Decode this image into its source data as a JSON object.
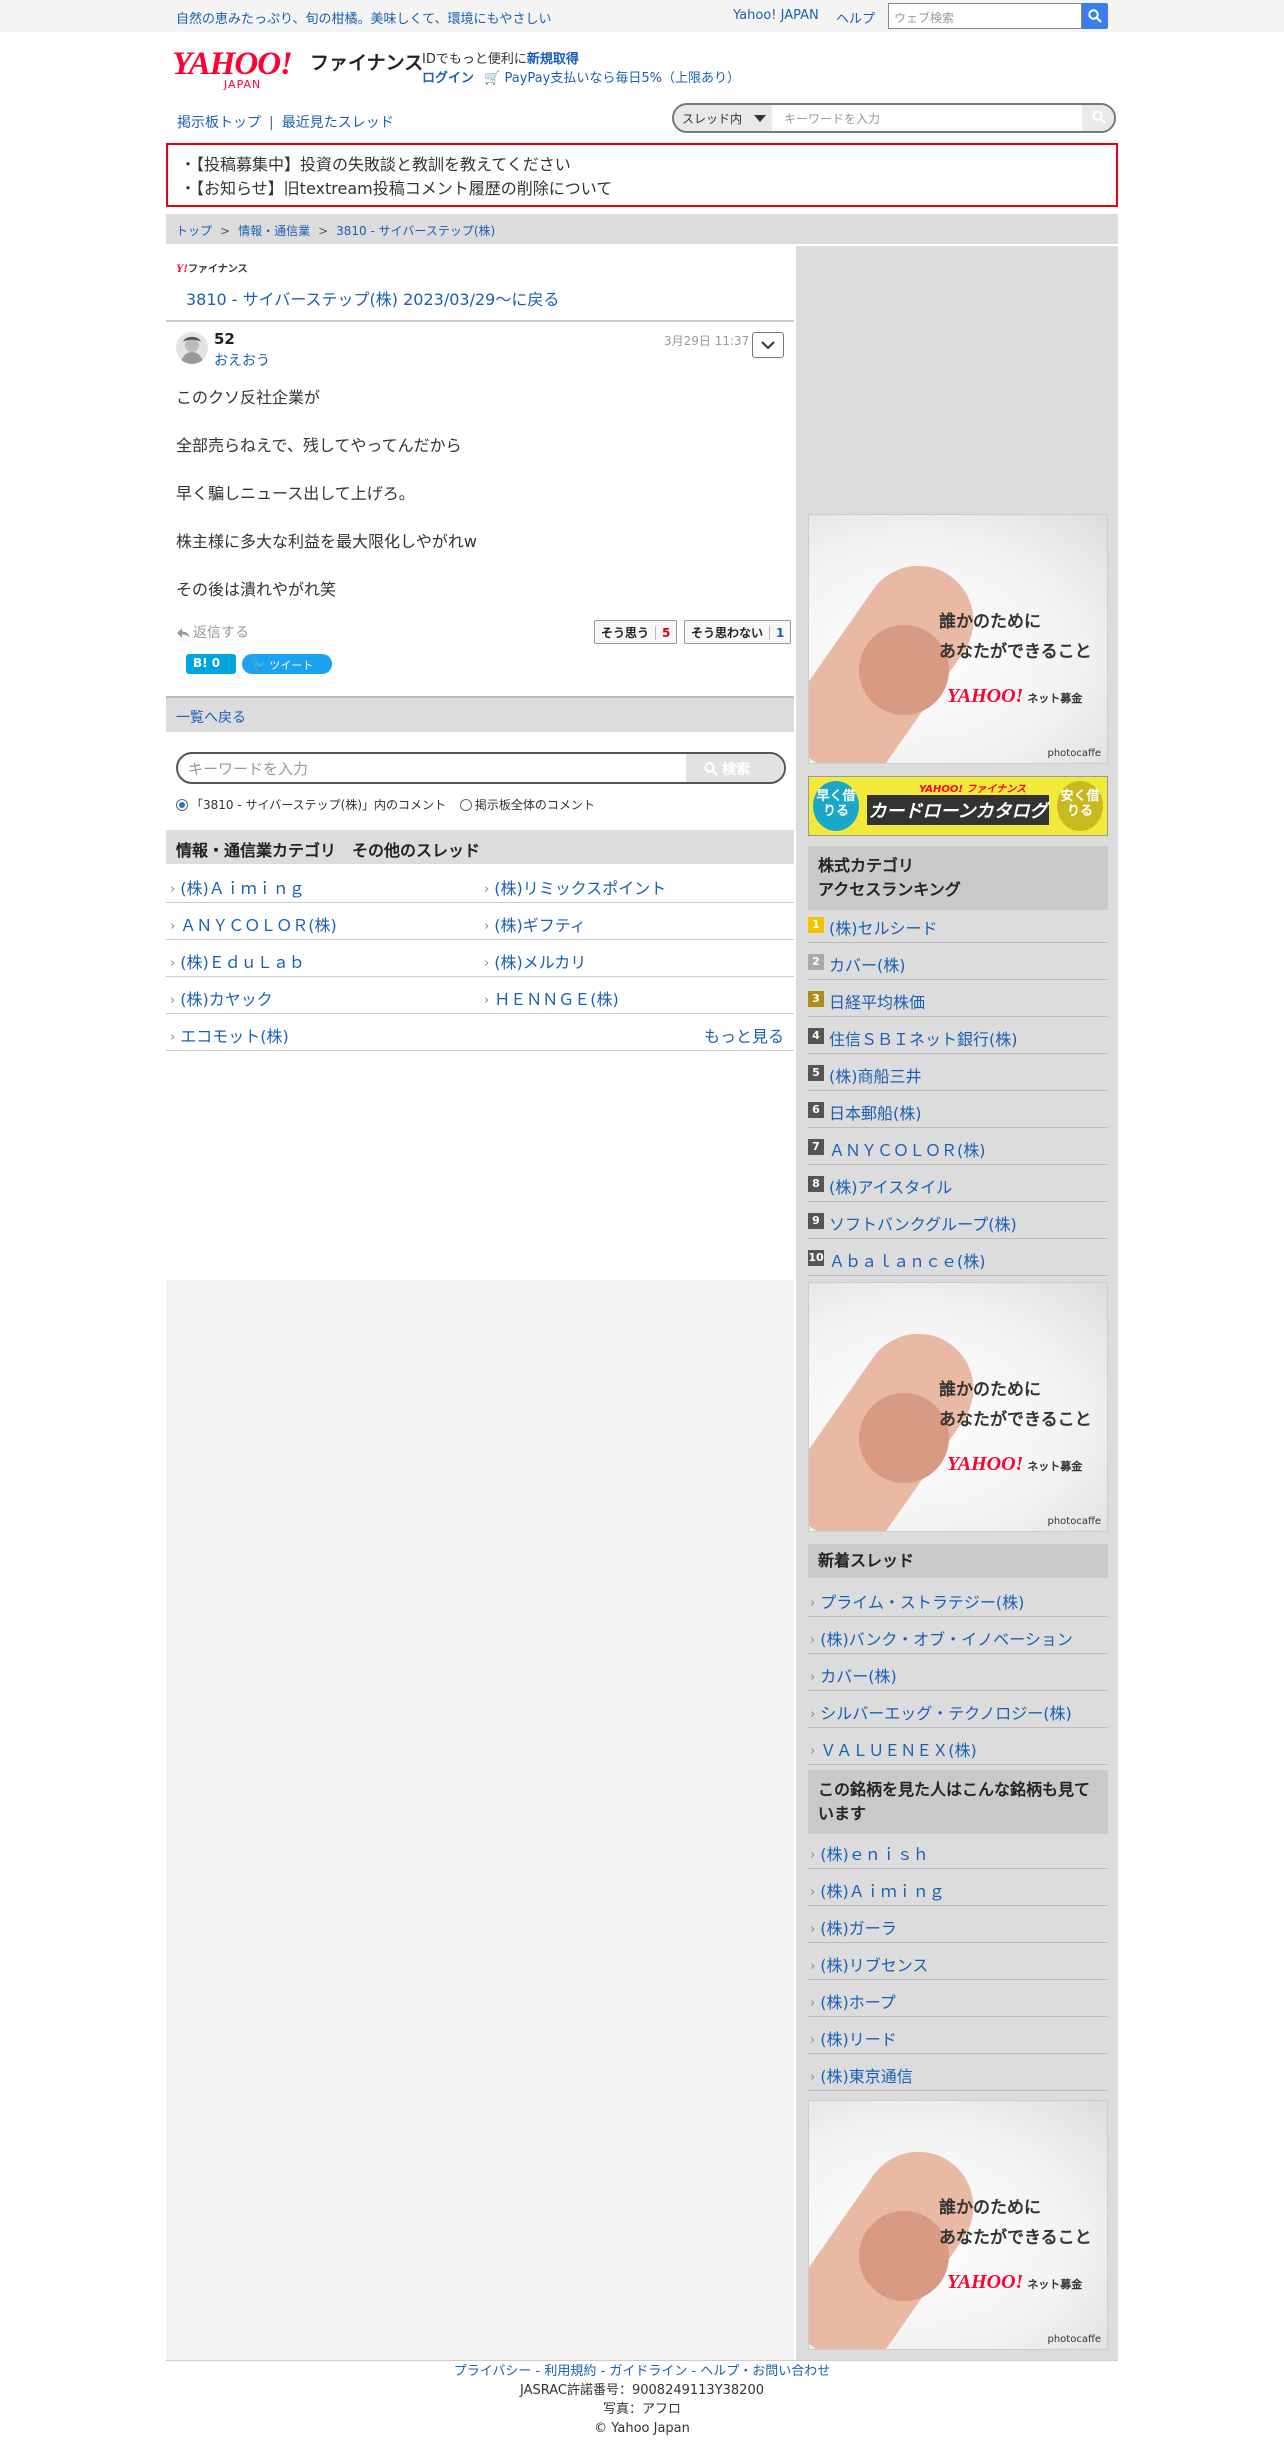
{
  "topbar": {
    "promo": "自然の恵みたっぷり、旬の柑橘。美味しくて、環境にもやさしい",
    "yahoo_japan": "Yahoo! JAPAN",
    "help": "ヘルプ",
    "web_search_placeholder": "ウェブ検索"
  },
  "header": {
    "logo": "YAHOO!",
    "logo_sub": "JAPAN",
    "brand": "ファイナンス",
    "id_text": "IDでもっと便利に",
    "signup": "新規取得",
    "login": "ログイン",
    "paypay": "PayPay支払いなら毎日5%（上限あり）"
  },
  "nav": {
    "board_top": "掲示板トップ",
    "sep": "|",
    "recent_threads": "最近見たスレッド",
    "search_scope": "スレッド内",
    "search_placeholder": "キーワードを入力"
  },
  "notices": [
    "・【投稿募集中】投資の失敗談と教訓を教えてください",
    "・【お知らせ】旧textream投稿コメント履歴の削除について"
  ],
  "breadcrumb": [
    "トップ",
    ">",
    "情報・通信業",
    ">",
    "3810 - サイバーステップ(株)"
  ],
  "post": {
    "mini_logo": "Y!",
    "mini_brand": "ファイナンス",
    "thread_back": "3810 - サイバーステップ(株) 2023/03/29〜に戻る",
    "number": "52",
    "user": "おえおう",
    "date": "3月29日 11:37",
    "lines": [
      "このクソ反社企業が",
      "",
      "全部売らねえで、残してやってんだから",
      "",
      "早く騙しニュース出して上げろ。",
      "",
      "株主様に多大な利益を最大限化しやがれw",
      "",
      "その後は潰れやがれ笑"
    ],
    "reply": "返信する",
    "agree_label": "そう思う",
    "agree_count": "5",
    "disagree_label": "そう思わない",
    "disagree_count": "1",
    "hatena": "B! 0",
    "tweet": "ツイート"
  },
  "list_back": "一覧へ戻る",
  "keyword_search": {
    "placeholder": "キーワードを入力",
    "button": "検索",
    "radio_thread": "「3810 - サイバーステップ(株)」内のコメント",
    "radio_all": "掲示板全体のコメント"
  },
  "other_threads": {
    "heading": "情報・通信業カテゴリ　その他のスレッド",
    "rows": [
      [
        "(株)Ａｉｍｉｎｇ",
        "(株)リミックスポイント"
      ],
      [
        "ＡＮＹＣＯＬＯＲ(株)",
        "(株)ギフティ"
      ],
      [
        "(株)ＥｄｕＬａｂ",
        "(株)メルカリ"
      ],
      [
        "(株)カヤック",
        "ＨＥＮＮＧＥ(株)"
      ]
    ],
    "last": "エコモット(株)",
    "more": "もっと見る"
  },
  "ad": {
    "caption1": "誰かのために",
    "caption2": "あなたができること",
    "logo": "YAHOO!",
    "service": "ネット募金",
    "credit": "photocaffe"
  },
  "card_ad": {
    "left": "早く借りる",
    "brand": "YAHOO! ファイナンス",
    "main": "カードローンカタログ",
    "right": "安く借りる"
  },
  "ranking": {
    "heading1": "株式カテゴリ",
    "heading2": "アクセスランキング",
    "items": [
      {
        "rank": "1",
        "name": "(株)セルシード"
      },
      {
        "rank": "2",
        "name": "カバー(株)"
      },
      {
        "rank": "3",
        "name": "日経平均株価"
      },
      {
        "rank": "4",
        "name": "住信ＳＢＩネット銀行(株)"
      },
      {
        "rank": "5",
        "name": "(株)商船三井"
      },
      {
        "rank": "6",
        "name": "日本郵船(株)"
      },
      {
        "rank": "7",
        "name": "ＡＮＹＣＯＬＯＲ(株)"
      },
      {
        "rank": "8",
        "name": "(株)アイスタイル"
      },
      {
        "rank": "9",
        "name": "ソフトバンクグループ(株)"
      },
      {
        "rank": "10",
        "name": "Ａｂａｌａｎｃｅ(株)"
      }
    ]
  },
  "new_threads": {
    "heading": "新着スレッド",
    "items": [
      "プライム・ストラテジー(株)",
      "(株)バンク・オブ・イノベーション",
      "カバー(株)",
      "シルバーエッグ・テクノロジー(株)",
      "ＶＡＬＵＥＮＥＸ(株)"
    ]
  },
  "also_viewed": {
    "heading": "この銘柄を見た人はこんな銘柄も見ています",
    "items": [
      "(株)ｅｎｉｓｈ",
      "(株)Ａｉｍｉｎｇ",
      "(株)ガーラ",
      "(株)リブセンス",
      "(株)ホープ",
      "(株)リード",
      "(株)東京通信"
    ]
  },
  "footer": {
    "links": "プライバシー - 利用規約 - ガイドライン - ヘルプ・お問い合わせ",
    "jasrac": "JASRAC許諾番号：9008249113Y38200",
    "photo": "写真：アフロ",
    "copyright": "© Yahoo Japan"
  }
}
